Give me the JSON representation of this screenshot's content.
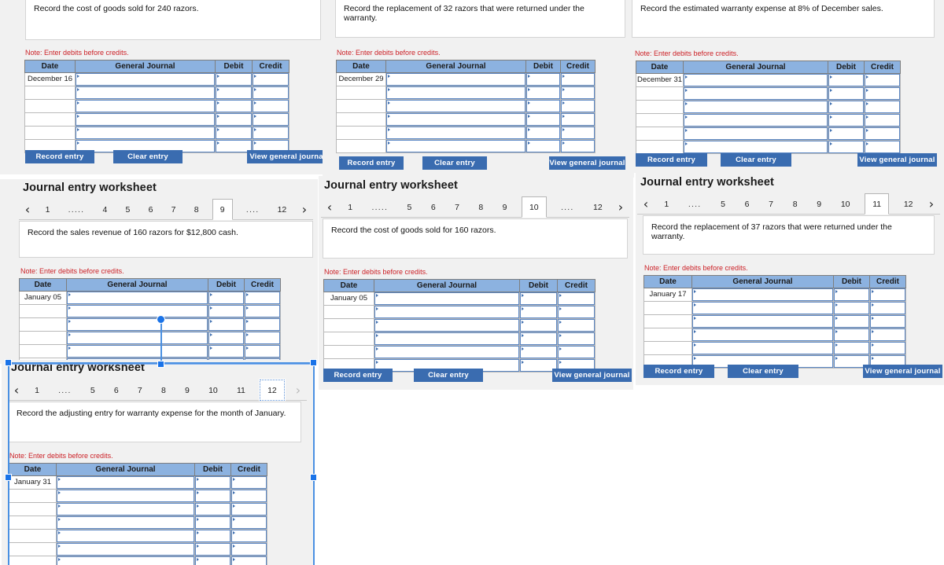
{
  "app": {
    "background_color": "#ffffff",
    "panel_background": "#f1f1f1",
    "accent_color": "#3a6cb0",
    "table_header_color": "#8cb2e0",
    "note_color": "#cc2127",
    "selection_color": "#4a90e2"
  },
  "common": {
    "worksheet_title": "Journal entry worksheet",
    "note": "Note: Enter debits before credits.",
    "columns": [
      "Date",
      "General Journal",
      "Debit",
      "Credit"
    ],
    "buttons": {
      "record": "Record entry",
      "clear": "Clear entry",
      "view": "View general journal"
    },
    "prev_icon": "chevron-left-icon",
    "next_icon": "chevron-right-icon",
    "prev_glyph": "‹",
    "next_glyph": "›",
    "ellipsis": "....",
    "ellipsis_long": "....."
  },
  "panels": [
    {
      "id": "panel-1",
      "prompt": "Record the cost of goods sold for 240 razors.",
      "date": "December 16",
      "row_count": 6,
      "pager": null,
      "title": null
    },
    {
      "id": "panel-2",
      "prompt": "Record the replacement of 32 razors that were returned under the warranty.",
      "date": "December 29",
      "row_count": 6,
      "pager": null,
      "title": null
    },
    {
      "id": "panel-3",
      "prompt": "Record the estimated warranty expense at 8% of December sales.",
      "date": "December 31",
      "row_count": 6,
      "pager": null,
      "title": null
    },
    {
      "id": "panel-4",
      "title": "Journal entry worksheet",
      "prompt": "Record the sales revenue of 160 razors for $12,800 cash.",
      "date": "January 05",
      "row_count": 6,
      "pager": {
        "items": [
          "1",
          ".....",
          "4",
          "5",
          "6",
          "7",
          "8",
          "9",
          "....",
          "12"
        ],
        "active": "9",
        "active_index": 7,
        "focused": false,
        "prev_enabled": true,
        "next_enabled": true
      }
    },
    {
      "id": "panel-5",
      "title": "Journal entry worksheet",
      "prompt": "Record the cost of goods sold for 160 razors.",
      "date": "January 05",
      "row_count": 6,
      "pager": {
        "items": [
          "1",
          ".....",
          "5",
          "6",
          "7",
          "8",
          "9",
          "10",
          "....",
          "12"
        ],
        "active": "10",
        "active_index": 7,
        "focused": false,
        "prev_enabled": true,
        "next_enabled": true
      }
    },
    {
      "id": "panel-6",
      "title": "Journal entry worksheet",
      "prompt": "Record the replacement of 37 razors that were returned under the warranty.",
      "date": "January 17",
      "row_count": 6,
      "pager": {
        "items": [
          "1",
          "....",
          "5",
          "6",
          "7",
          "8",
          "9",
          "10",
          "11",
          "12"
        ],
        "active": "11",
        "active_index": 8,
        "focused": false,
        "prev_enabled": true,
        "next_enabled": true
      }
    },
    {
      "id": "panel-7",
      "title": "Journal entry worksheet",
      "prompt": "Record the adjusting entry for warranty expense for the month of January.",
      "date": "January 31",
      "row_count": 7,
      "selected": true,
      "pager": {
        "items": [
          "1",
          "....",
          "5",
          "6",
          "7",
          "8",
          "9",
          "10",
          "11",
          "12"
        ],
        "active": "12",
        "active_index": 9,
        "focused": true,
        "prev_enabled": true,
        "next_enabled": false
      }
    }
  ],
  "selection": {
    "handle_icon": "resize-handle",
    "rotation_icon": "rotation-handle"
  }
}
